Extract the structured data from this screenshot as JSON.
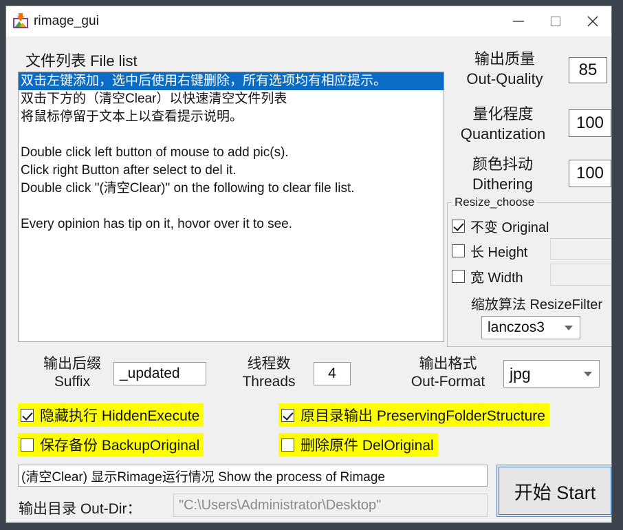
{
  "window": {
    "title": "rimage_gui",
    "icon": "app-image-download-icon",
    "controls": {
      "minimize": "minimize-icon",
      "maximize": "maximize-icon",
      "close": "close-icon"
    }
  },
  "filelist": {
    "label": "文件列表 File list",
    "items": [
      "双击左键添加，选中后使用右键删除，所有选项均有相应提示。",
      "双击下方的（清空Clear）以快速清空文件列表",
      "将鼠标停留于文本上以查看提示说明。",
      "",
      "Double click left button of mouse to add pic(s).",
      "Click right Button after select to del it.",
      "Double click \"(清空Clear)\" on the following to clear file list.",
      "",
      "Every opinion has tip on it, hovor over it to see."
    ],
    "selected_index": 0
  },
  "quality": {
    "label_cn": "输出质量",
    "label_en": "Out-Quality",
    "value": "85"
  },
  "quantization": {
    "label_cn": "量化程度",
    "label_en": "Quantization",
    "value": "100"
  },
  "dithering": {
    "label_cn": "颜色抖动",
    "label_en": "Dithering",
    "value": "100"
  },
  "resize_choose": {
    "title": "Resize_choose",
    "original": {
      "label": "不变 Original",
      "checked": true
    },
    "height": {
      "label": "长 Height",
      "checked": false,
      "value": ""
    },
    "width": {
      "label": "宽 Width",
      "checked": false,
      "value": ""
    },
    "filter_label": "缩放算法 ResizeFilter",
    "filter_value": "lanczos3"
  },
  "suffix": {
    "label_cn": "输出后缀",
    "label_en": "Suffix",
    "value": "_updated"
  },
  "threads": {
    "label_cn": "线程数",
    "label_en": "Threads",
    "value": "4"
  },
  "out_format": {
    "label_cn": "输出格式",
    "label_en": "Out-Format",
    "value": "jpg"
  },
  "options": [
    {
      "label": "隐藏执行 HiddenExecute",
      "checked": true
    },
    {
      "label": "原目录输出 PreservingFolderStructure",
      "checked": true
    },
    {
      "label": "保存备份 BackupOriginal",
      "checked": false
    },
    {
      "label": "删除原件 DelOriginal",
      "checked": false
    }
  ],
  "status": {
    "text": "(清空Clear) 显示Rimage运行情况 Show the process of Rimage"
  },
  "outdir": {
    "label": "输出目录 Out-Dir：",
    "value": "\"C:\\Users\\Administrator\\Desktop\""
  },
  "start_button": {
    "label": "开始 Start"
  },
  "colors": {
    "selection_blue": "#0a6cc4",
    "highlight_yellow": "#ffff00",
    "window_bg": "#f0f0f0",
    "desktop_bg": "#3b444e",
    "button_border": "#3a7cc0"
  }
}
